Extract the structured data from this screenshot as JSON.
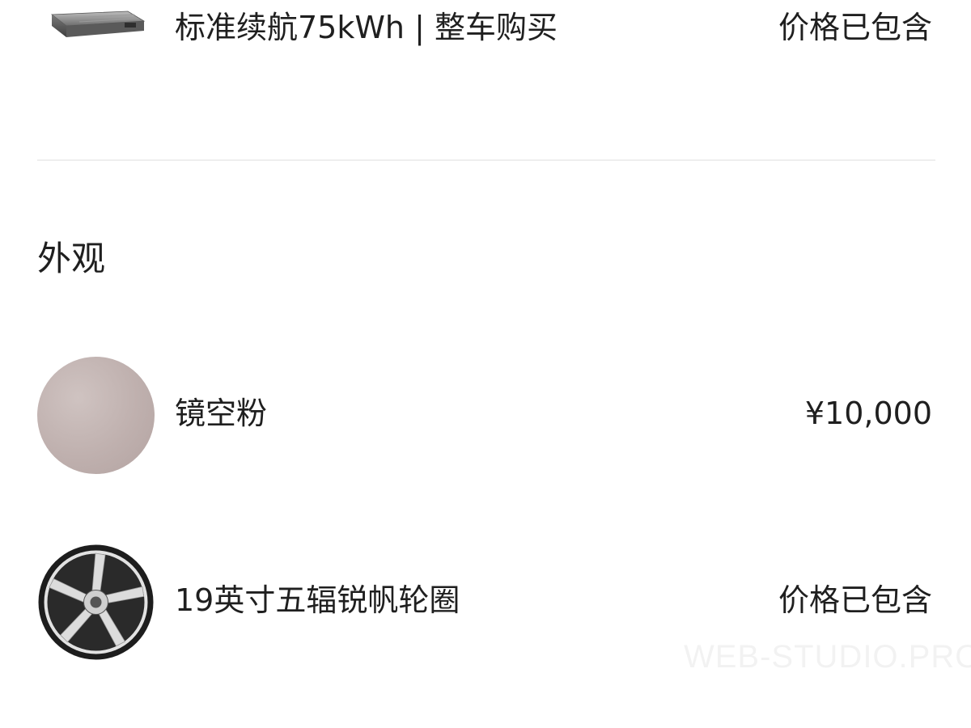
{
  "battery_item": {
    "icon": "battery-pack-icon",
    "label": "标准续航75kWh | 整车购买",
    "price": "价格已包含"
  },
  "exterior": {
    "section_title": "外观",
    "color": {
      "label": "镜空粉",
      "price": "¥10,000",
      "swatch_color": "#bfb0ae"
    },
    "wheel": {
      "icon": "wheel-rim-icon",
      "label": "19英寸五辐锐帆轮圈",
      "price": "价格已包含"
    }
  },
  "watermark": "WEB-STUDIO.PRO"
}
